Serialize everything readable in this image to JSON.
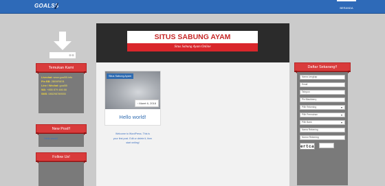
{
  "header": {
    "logo_text": "GOALSS",
    "nav_home": "BERANDA"
  },
  "left_sidebar": {
    "find_us": {
      "title": "Temukan Kami",
      "lines": [
        {
          "label": "Livechat",
          "value": ": www.goal55.info"
        },
        {
          "label": "Pin BB",
          "value": ": 2BB9F8EB"
        },
        {
          "label": "Line / Wechat",
          "value": ": goal55"
        },
        {
          "label": "WA",
          "value": ": +855 879 486 88"
        },
        {
          "label": "SMS",
          "value": ": 085298789555"
        }
      ]
    },
    "new_post": {
      "title": "New Post!!",
      "link": "Hello world!"
    },
    "follow": {
      "title": "Follow Us!"
    }
  },
  "site": {
    "title": "SITUS SABUNG AYAM",
    "subtitle": "Situs Sabung Ayam Online"
  },
  "post": {
    "tag": "Situs Sabung Ayam",
    "date": "Maret 6, 2018",
    "title": "Hello world!",
    "excerpt": [
      "Welcome to WordPress. This is",
      "your first post. Edit or delete it, then",
      "start writing!"
    ]
  },
  "register": {
    "title": "Daftar Sekarang!!",
    "fields": [
      {
        "name": "full-name",
        "placeholder": "Nama Lengkap",
        "type": "text"
      },
      {
        "name": "email",
        "placeholder": "Email",
        "type": "text"
      },
      {
        "name": "phone",
        "placeholder": "Telepon",
        "type": "text"
      },
      {
        "name": "pin-bb",
        "placeholder": "Pin Blackberry",
        "type": "text"
      },
      {
        "name": "bank",
        "placeholder": "Pilih Rekening",
        "type": "select"
      },
      {
        "name": "game",
        "placeholder": "Pilih Permainan",
        "type": "select"
      },
      {
        "name": "bank-name",
        "placeholder": "Pilih Bank",
        "type": "select"
      },
      {
        "name": "account-name",
        "placeholder": "Nama Rekening",
        "type": "text"
      },
      {
        "name": "account-number",
        "placeholder": "Nomor Rekening",
        "type": "text"
      }
    ],
    "captcha": "ertca"
  },
  "colors": {
    "accent_red": "#d93b3b",
    "topbar_blue": "#2e6ab8",
    "link_blue": "#3c6fbf"
  }
}
